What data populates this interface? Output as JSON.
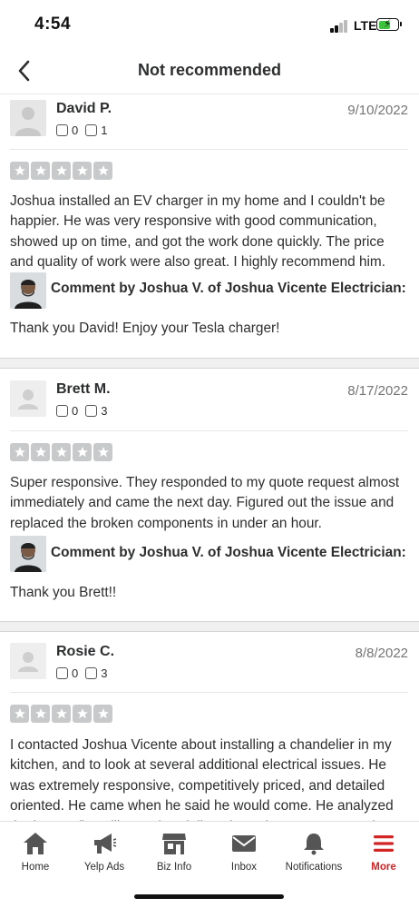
{
  "status_bar": {
    "time": "4:54",
    "network": "LTE"
  },
  "header": {
    "title": "Not recommended"
  },
  "reviews": [
    {
      "name": "David P.",
      "date": "9/10/2022",
      "friends": "0",
      "review_count": "1",
      "rating": 5,
      "text": "Joshua installed an EV charger in my home and I couldn't be happier. He was very responsive with good communication, showed up on time, and got the work done quickly. The price and quality of work were also great. I highly recommend him.",
      "owner_comment_label": "Comment by Joshua V. of Joshua Vicente Electrician:",
      "owner_reply": "Thank you David! Enjoy your Tesla charger!"
    },
    {
      "name": "Brett M.",
      "date": "8/17/2022",
      "friends": "0",
      "review_count": "3",
      "rating": 5,
      "text": "Super responsive. They responded to my quote request almost immediately and came the next day. Figured out the issue and replaced the broken components in under an hour.",
      "owner_comment_label": "Comment by Joshua V. of Joshua Vicente Electrician:",
      "owner_reply": "Thank you Brett!!"
    },
    {
      "name": "Rosie C.",
      "date": "8/8/2022",
      "friends": "0",
      "review_count": "3",
      "rating": 5,
      "text": "I contacted Joshua Vicente about installing a chandelier in my kitchen, and to look at several additional electrical issues. He was extremely responsive, competitively priced, and detailed oriented. He came when he said he would come. He analyzed the issues (installing a chandelier where there was no previous"
    }
  ],
  "tab_bar": {
    "items": [
      {
        "label": "Home",
        "icon": "home-icon"
      },
      {
        "label": "Yelp Ads",
        "icon": "megaphone-icon"
      },
      {
        "label": "Biz Info",
        "icon": "storefront-icon"
      },
      {
        "label": "Inbox",
        "icon": "envelope-icon"
      },
      {
        "label": "Notifications",
        "icon": "bell-icon"
      },
      {
        "label": "More",
        "icon": "hamburger-menu-icon"
      }
    ],
    "active": "More",
    "active_color": "#d32323",
    "icon_color": "#555555"
  },
  "colors": {
    "star_inactive": "#c8c9ca",
    "section_gap": "#f0f0f0"
  }
}
